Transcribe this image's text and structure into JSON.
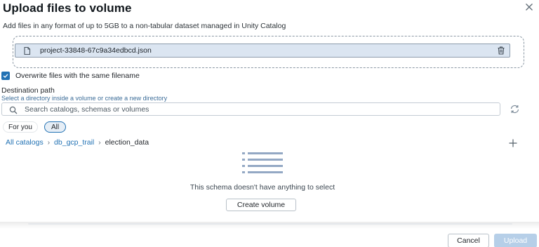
{
  "dialog": {
    "title": "Upload files to volume",
    "subtitle": "Add files in any format of up to 5GB to a non-tabular dataset managed in Unity Catalog"
  },
  "file": {
    "name": "project-33848-67c9a34edbcd.json",
    "icon": "file-icon"
  },
  "overwrite": {
    "label": "Overwrite files with the same filename",
    "checked": true
  },
  "destination": {
    "label": "Destination path",
    "hint": "Select a directory inside a volume or create a new directory"
  },
  "search": {
    "placeholder": "Search catalogs, schemas or volumes",
    "value": ""
  },
  "filters": {
    "for_you": "For you",
    "all": "All",
    "selected": "All"
  },
  "breadcrumb": {
    "items": [
      "All catalogs",
      "db_gcp_trail",
      "election_data"
    ],
    "separator": "›"
  },
  "empty_state": {
    "message": "This schema doesn't have anything to select",
    "create_label": "Create volume"
  },
  "footer": {
    "cancel_label": "Cancel",
    "upload_label": "Upload"
  },
  "colors": {
    "accent": "#2272b4",
    "file_row_bg": "#dbe5f1",
    "upload_disabled_bg": "#b6cfe8"
  }
}
